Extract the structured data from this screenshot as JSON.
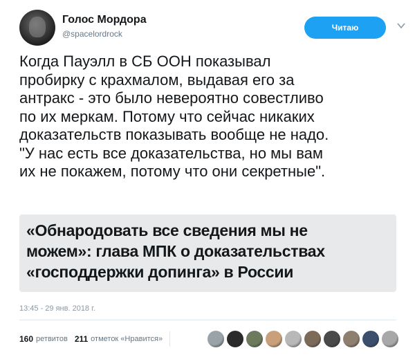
{
  "header": {
    "display_name": "Голос Мордора",
    "handle": "@spacelordrock",
    "follow_label": "Читаю"
  },
  "tweet": {
    "text": "Когда Пауэлл в СБ ООН показывал\nпробирку с крахмалом, выдавая его за\nантракс - это было невероятно совестливо\nпо их меркам. Потому что сейчас никаких\nдоказательств показывать вообще не надо.\n\"У нас есть все доказательства, но мы вам\nих не покажем, потому что они секретные\"."
  },
  "quote": {
    "text": "«Обнародовать все сведения мы не\nможем»: глава МПК о доказательствах\n«господдержки допинга» в России"
  },
  "timestamp": "13:45 - 29 янв. 2018 г.",
  "stats": {
    "retweets_count": "160",
    "retweets_label": "ретвитов",
    "likes_count": "211",
    "likes_label": "отметок «Нравится»"
  },
  "likers": {
    "colors": [
      "#9aa3a8",
      "#2b2b2b",
      "#6e7a5e",
      "#c9a07a",
      "#b8b8b8",
      "#7d6b5a",
      "#4a4a4a",
      "#8f7f6f",
      "#3d4f6e",
      "#a8a8a8"
    ]
  }
}
